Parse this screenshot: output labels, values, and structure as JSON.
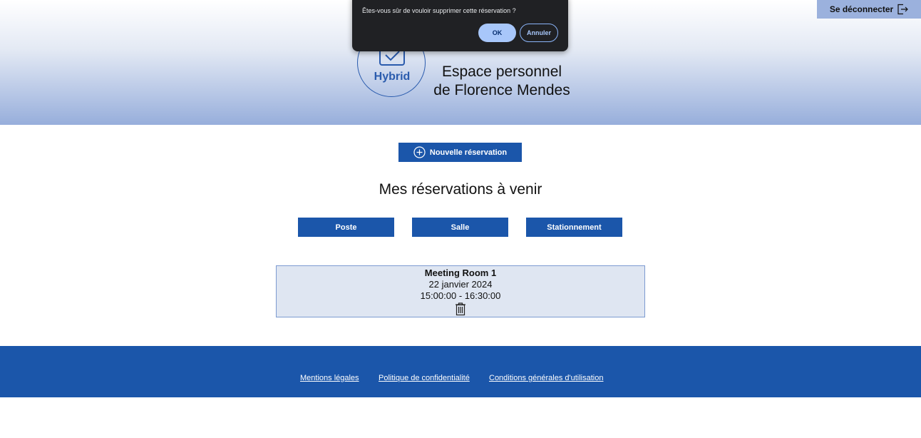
{
  "header": {
    "logout_label": "Se déconnecter",
    "logo_text": "Hybrid",
    "title_line1": "Espace personnel",
    "title_line2": "de Florence Mendes"
  },
  "dialog": {
    "message": "Êtes-vous sûr de vouloir supprimer cette réservation ?",
    "ok_label": "OK",
    "cancel_label": "Annuler"
  },
  "main": {
    "new_reservation_label": "Nouvelle réservation",
    "upcoming_title": "Mes réservations à venir",
    "filters": [
      "Poste",
      "Salle",
      "Stationnement"
    ],
    "reservation": {
      "room": "Meeting Room 1",
      "date": "22 janvier 2024",
      "time": "15:00:00 - 16:30:00"
    }
  },
  "footer": {
    "links": [
      "Mentions légales",
      "Politique de confidentialité",
      "Conditions générales d'utilisation"
    ]
  },
  "colors": {
    "primary": "#1b56aa",
    "card_bg": "#dfe6f2",
    "dialog_bg": "#202124"
  }
}
